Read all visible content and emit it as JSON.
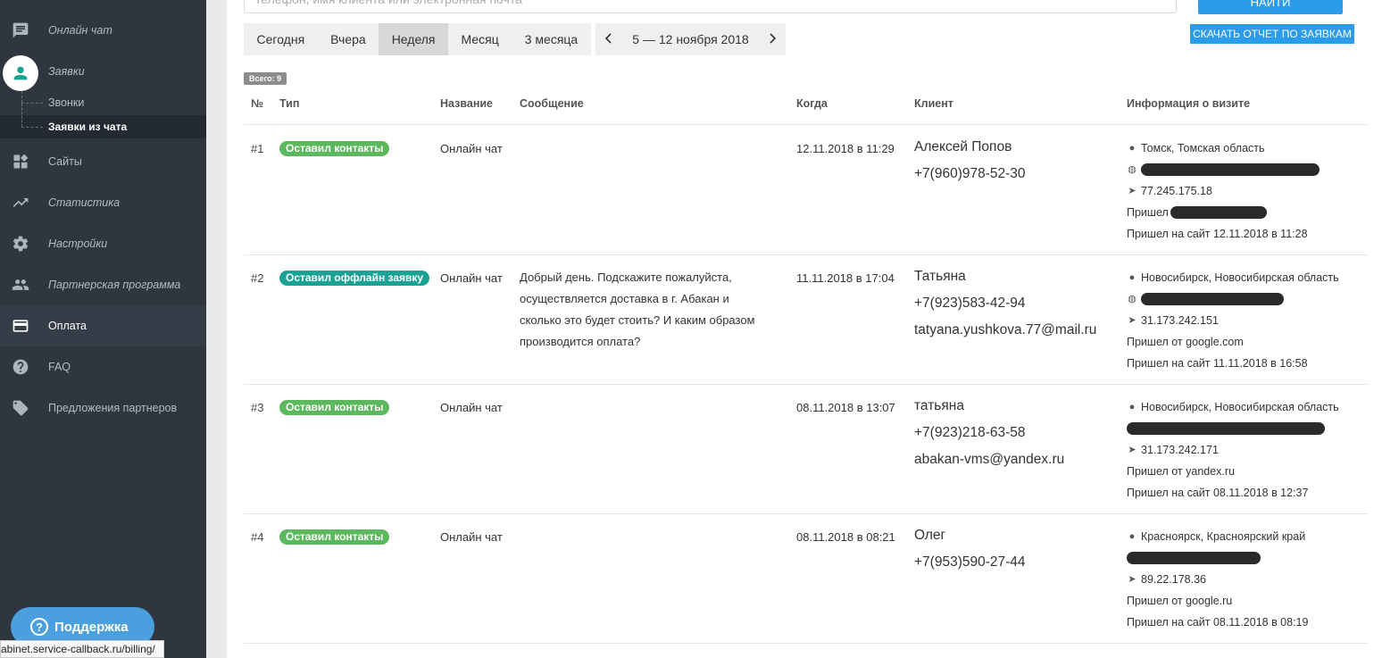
{
  "sidebar": {
    "items": [
      {
        "label": "Онлайн чат",
        "icon": "chat-icon"
      },
      {
        "label": "Заявки",
        "icon": "user-icon"
      },
      {
        "label": "Сайты",
        "icon": "dashboard-icon"
      },
      {
        "label": "Статистика",
        "icon": "trending-up-icon"
      },
      {
        "label": "Настройки",
        "icon": "gear-icon"
      },
      {
        "label": "Партнерская программа",
        "icon": "people-icon"
      },
      {
        "label": "Оплата",
        "icon": "credit-card-icon"
      },
      {
        "label": "FAQ",
        "icon": "help-icon"
      },
      {
        "label": "Предложения партнеров",
        "icon": "tag-icon"
      }
    ],
    "subitems": [
      {
        "label": "Звонки"
      },
      {
        "label": "Заявки из чата"
      }
    ],
    "support_label": "Поддержка"
  },
  "statusbar": {
    "url": "abinet.service-callback.ru/billing/"
  },
  "toolbar": {
    "search_placeholder": "телефон, имя клиента или электронная почта",
    "find_label": "НАЙТИ",
    "report_label": "СКАЧАТЬ ОТЧЕТ ПО ЗАЯВКАМ",
    "periods": [
      "Сегодня",
      "Вчера",
      "Неделя",
      "Месяц",
      "3 месяца"
    ],
    "selected_period": "Неделя",
    "date_range": "5 — 12 ноября 2018",
    "prev_icon": "chevron-left-icon",
    "next_icon": "chevron-right-icon"
  },
  "total_label": "Всего: 9",
  "table": {
    "headers": [
      "№",
      "Тип",
      "Название",
      "Сообщение",
      "Когда",
      "Клиент",
      "Информация о визите"
    ],
    "rows": [
      {
        "num": "#1",
        "type": "Оставил контакты",
        "type_color": "#5cb85c",
        "name": "Онлайн чат",
        "message": "",
        "when": "12.11.2018 в 11:29",
        "client": [
          "Алексей Попов",
          "+7(960)978-52-30"
        ],
        "location": "Томск, Томская область",
        "ip": "77.245.175.18",
        "came_from": "Пришел",
        "came_at": "Пришел на сайт 12.11.2018 в 11:28"
      },
      {
        "num": "#2",
        "type": "Оставил оффлайн заявку",
        "type_color": "#1aa394",
        "name": "Онлайн чат",
        "message": "Добрый день. Подскажите пожалуйста, осуществляется доставка в г. Абакан и сколько это будет стоить? И каким образом производится оплата?",
        "when": "11.11.2018 в 17:04",
        "client": [
          "Татьяна",
          "+7(923)583-42-94",
          "tatyana.yushkova.77@mail.ru"
        ],
        "location": "Новосибирск, Новосибирская область",
        "ip": "31.173.242.151",
        "came_from": "Пришел от google.com",
        "came_at": "Пришел на сайт 11.11.2018 в 16:58"
      },
      {
        "num": "#3",
        "type": "Оставил контакты",
        "type_color": "#5cb85c",
        "name": "Онлайн чат",
        "message": "",
        "when": "08.11.2018 в 13:07",
        "client": [
          "татьяна",
          "+7(923)218-63-58",
          "abakan-vms@yandex.ru"
        ],
        "location": "Новосибирск, Новосибирская область",
        "ip": "31.173.242.171",
        "came_from": "Пришел от yandex.ru",
        "came_at": "Пришел на сайт 08.11.2018 в 12:37"
      },
      {
        "num": "#4",
        "type": "Оставил контакты",
        "type_color": "#5cb85c",
        "name": "Онлайн чат",
        "message": "",
        "when": "08.11.2018 в 08:21",
        "client": [
          "Олег",
          "+7(953)590-27-44"
        ],
        "location": "Красноярск, Красноярский край",
        "ip": "89.22.178.36",
        "came_from": "Пришел от google.ru",
        "came_at": "Пришел на сайт 08.11.2018 в 08:19"
      }
    ]
  }
}
